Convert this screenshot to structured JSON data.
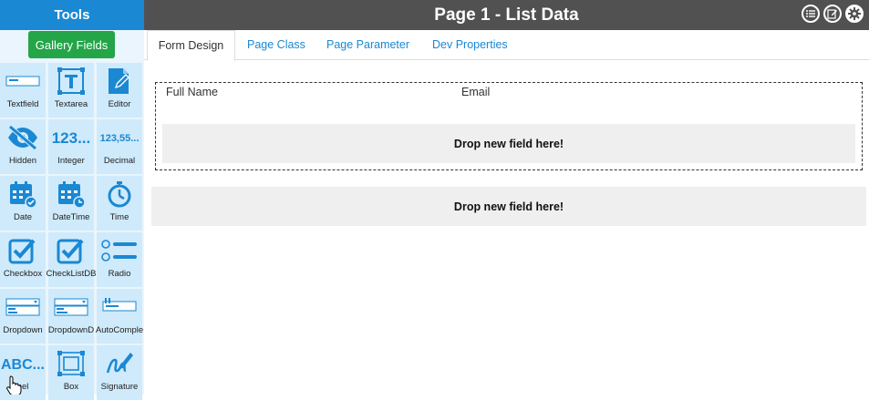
{
  "sidebar": {
    "title": "Tools",
    "gallery_button": "Gallery Fields",
    "tools": [
      {
        "label": "Textfield",
        "icon": "textfield-icon"
      },
      {
        "label": "Textarea",
        "icon": "textarea-icon"
      },
      {
        "label": "Editor",
        "icon": "editor-icon"
      },
      {
        "label": "Hidden",
        "icon": "eye-slash-icon"
      },
      {
        "label": "Integer",
        "icon": "integer-icon"
      },
      {
        "label": "Decimal",
        "icon": "decimal-icon"
      },
      {
        "label": "Date",
        "icon": "calendar-check-icon"
      },
      {
        "label": "DateTime",
        "icon": "calendar-clock-icon"
      },
      {
        "label": "Time",
        "icon": "stopwatch-icon"
      },
      {
        "label": "Checkbox",
        "icon": "checkbox-icon"
      },
      {
        "label": "CheckListDB",
        "icon": "checklist-icon"
      },
      {
        "label": "Radio",
        "icon": "radio-icon"
      },
      {
        "label": "Dropdown",
        "icon": "dropdown-icon"
      },
      {
        "label": "DropdownD",
        "icon": "dropdown-db-icon"
      },
      {
        "label": "AutoComple",
        "icon": "autocomplete-icon"
      },
      {
        "label": "bel",
        "icon": "label-icon"
      },
      {
        "label": "Box",
        "icon": "box-icon"
      },
      {
        "label": "Signature",
        "icon": "signature-icon"
      }
    ]
  },
  "header": {
    "title": "Page 1 - List Data",
    "icons": [
      "list-icon",
      "edit-icon",
      "gear-icon"
    ]
  },
  "tabs": [
    {
      "label": "Form Design",
      "active": true
    },
    {
      "label": "Page Class",
      "active": false
    },
    {
      "label": "Page Parameter",
      "active": false
    },
    {
      "label": "Dev Properties",
      "active": false
    }
  ],
  "form": {
    "fields": [
      "Full Name",
      "Email"
    ],
    "inner_drop": "Drop new field here!",
    "outer_drop": "Drop new field here!"
  },
  "colors": {
    "accent": "#1a88d3",
    "tile": "#cfeafb",
    "green": "#23a548",
    "topbar": "#515151"
  }
}
